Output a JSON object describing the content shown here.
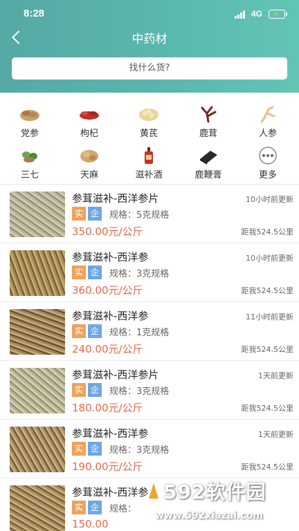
{
  "status_bar": {
    "time": "8:28",
    "network": "4G"
  },
  "header": {
    "title": "中药材"
  },
  "search": {
    "placeholder": "找什么货?"
  },
  "categories": [
    {
      "label": "党参",
      "icon": "dangshen-icon"
    },
    {
      "label": "枸杞",
      "icon": "goji-icon"
    },
    {
      "label": "黄芪",
      "icon": "huangqi-icon"
    },
    {
      "label": "鹿茸",
      "icon": "antler-icon"
    },
    {
      "label": "人参",
      "icon": "ginseng-icon"
    },
    {
      "label": "三七",
      "icon": "sanqi-icon"
    },
    {
      "label": "天麻",
      "icon": "tianma-icon"
    },
    {
      "label": "滋补酒",
      "icon": "wine-icon"
    },
    {
      "label": "鹿鞭膏",
      "icon": "paste-icon"
    },
    {
      "label": "更多",
      "icon": "more-icon"
    }
  ],
  "tags": {
    "shi": "实",
    "qi": "企"
  },
  "products": [
    {
      "name": "参茸滋补-西洋参片",
      "updated": "10小时前更新",
      "spec": "规格：5克规格",
      "price": "350.00元/公斤",
      "distance": "距我524.5公里"
    },
    {
      "name": "参茸滋补-西洋参",
      "updated": "10小时前更新",
      "spec": "规格：3克规格",
      "price": "360.00元/公斤",
      "distance": "距我524.5公里"
    },
    {
      "name": "参茸滋补-西洋参",
      "updated": "11小时前更新",
      "spec": "规格：1克规格",
      "price": "240.00元/公斤",
      "distance": "距我524.5公里"
    },
    {
      "name": "参茸滋补-西洋参片",
      "updated": "1天前更新",
      "spec": "规格：3克规格",
      "price": "180.00元/公斤",
      "distance": "距我524.5公里"
    },
    {
      "name": "参茸滋补-西洋参",
      "updated": "1天前更新",
      "spec": "规格：3克规格",
      "price": "190.00元/公斤",
      "distance": "距我524.5公里"
    },
    {
      "name": "参茸滋补-西洋参",
      "updated": "",
      "spec": "规格：",
      "price": "150.00",
      "distance": ""
    }
  ],
  "watermark": {
    "brand": "592软件园",
    "url": "www.592xiazai.com"
  },
  "colors": {
    "header_start": "#55a9a4",
    "header_end": "#63c5b4",
    "price": "#e8674a",
    "tag_shi": "#f0a25a",
    "tag_qi": "#6fa6e6"
  }
}
